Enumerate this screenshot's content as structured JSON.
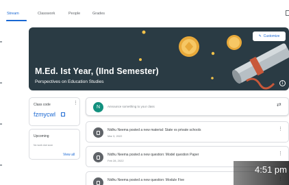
{
  "tabs": [
    "Stream",
    "Classwork",
    "People",
    "Grades"
  ],
  "banner": {
    "title": "M.Ed. Ist Year, (IInd Semester)",
    "subtitle": "Perspectives on Education Studies",
    "customize_label": "Customize",
    "info_glyph": "i"
  },
  "class_code": {
    "label": "Class code",
    "value": "fzmycwl"
  },
  "upcoming": {
    "label": "Upcoming",
    "empty_text": "No work due soon",
    "view_all": "View all"
  },
  "announce": {
    "avatar_letter": "N",
    "placeholder": "Announce something to your class"
  },
  "posts": [
    {
      "title": "Nidhu Neema posted a new material: State vs private schools",
      "date": "Mar 3, 2022",
      "icon": "material-icon"
    },
    {
      "title": "Nidhu Neema posted a new question: Model question Paper",
      "date": "Feb 28, 2022",
      "icon": "question-icon"
    },
    {
      "title": "Nidhu Neema posted a new question: Module Five",
      "date": "",
      "icon": "question-icon"
    }
  ],
  "overlay_time": "4:51 pm",
  "colors": {
    "accent": "#1967d2",
    "banner_bg": "#2a3b44",
    "avatar": "#12907e"
  }
}
